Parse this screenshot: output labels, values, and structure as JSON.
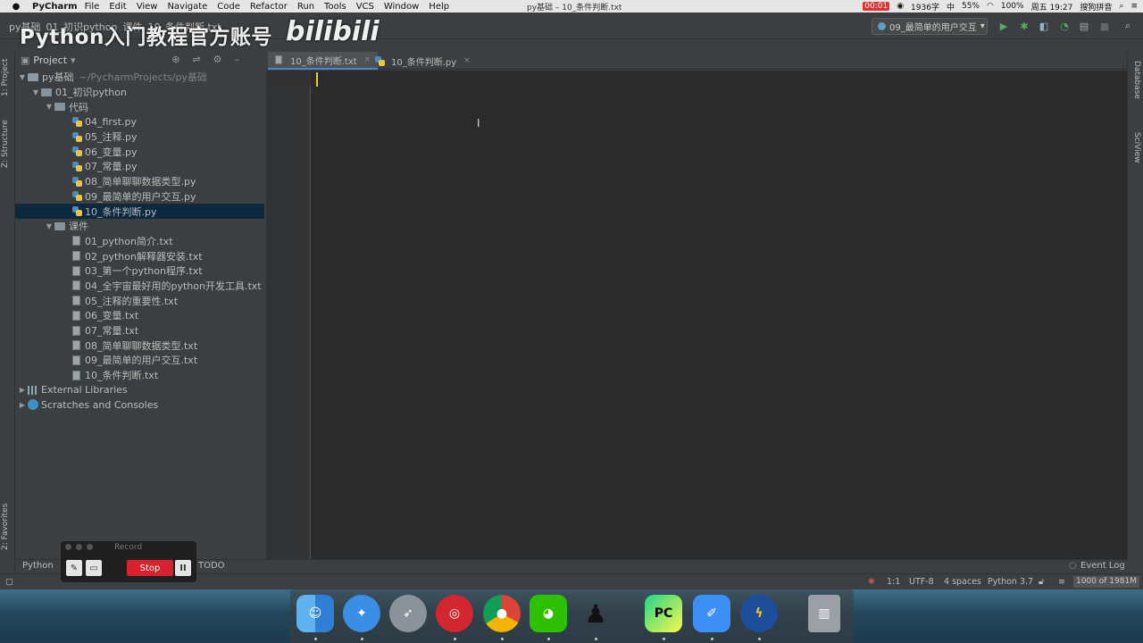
{
  "menubar": {
    "app": "PyCharm",
    "menus": [
      "File",
      "Edit",
      "View",
      "Navigate",
      "Code",
      "Refactor",
      "Run",
      "Tools",
      "VCS",
      "Window",
      "Help"
    ],
    "window_title": "py基础 – 10_条件判断.txt",
    "right": {
      "record_time": "00:01",
      "chars": "1936字",
      "ime1": "中",
      "cpu": "55%",
      "battery": "100%",
      "clock": "周五 19:27",
      "ime2": "搜狗拼音"
    }
  },
  "watermark": {
    "text": "Python入门教程官方账号",
    "logo": "bilibili"
  },
  "navbar": {
    "crumbs": [
      "py基础",
      "01_初识python",
      "课件",
      "10_条件判断.txt"
    ]
  },
  "run_config": {
    "label": "09_最简单的用户交互"
  },
  "side_tabs": {
    "project": "1: Project",
    "structure": "Z: Structure",
    "favorites": "2: Favorites",
    "database": "Database",
    "sciview": "SciView"
  },
  "project_panel": {
    "title": "Project",
    "tree": [
      {
        "label": "py基础",
        "path": "~/PycharmProjects/py基础"
      },
      {
        "label": "01_初识python"
      },
      {
        "label": "代码"
      },
      {
        "label": "04_first.py"
      },
      {
        "label": "05_注释.py"
      },
      {
        "label": "06_变量.py"
      },
      {
        "label": "07_常量.py"
      },
      {
        "label": "08_简单聊聊数据类型.py"
      },
      {
        "label": "09_最简单的用户交互.py"
      },
      {
        "label": "10_条件判断.py"
      },
      {
        "label": "课件"
      },
      {
        "label": "01_python简介.txt"
      },
      {
        "label": "02_python解释器安装.txt"
      },
      {
        "label": "03_第一个python程序.txt"
      },
      {
        "label": "04_全宇宙最好用的python开发工具.txt"
      },
      {
        "label": "05_注释的重要性.txt"
      },
      {
        "label": "06_变量.txt"
      },
      {
        "label": "07_常量.txt"
      },
      {
        "label": "08_简单聊聊数据类型.txt"
      },
      {
        "label": "09_最简单的用户交互.txt"
      },
      {
        "label": "10_条件判断.txt"
      },
      {
        "label": "External Libraries"
      },
      {
        "label": "Scratches and Consoles"
      }
    ]
  },
  "editor_tabs": [
    {
      "label": "10_条件判断.txt",
      "close": "×"
    },
    {
      "label": "10_条件判断.py",
      "close": "×"
    }
  ],
  "bottom_bar": {
    "python_console": "Python",
    "todo": "TODO",
    "event_log": "Event Log"
  },
  "status": {
    "position": "1:1",
    "encoding": "UTF-8",
    "indent": "4 spaces",
    "interpreter": "Python 3.7",
    "memory": "1000 of 1981M"
  },
  "record_widget": {
    "title": "Record",
    "stop": "Stop",
    "pause": "II"
  },
  "dock": [
    "finder",
    "safari",
    "launchpad",
    "netease-music",
    "chrome",
    "wechat",
    "qq",
    "pycharm",
    "feishu",
    "lightning",
    "trash"
  ]
}
